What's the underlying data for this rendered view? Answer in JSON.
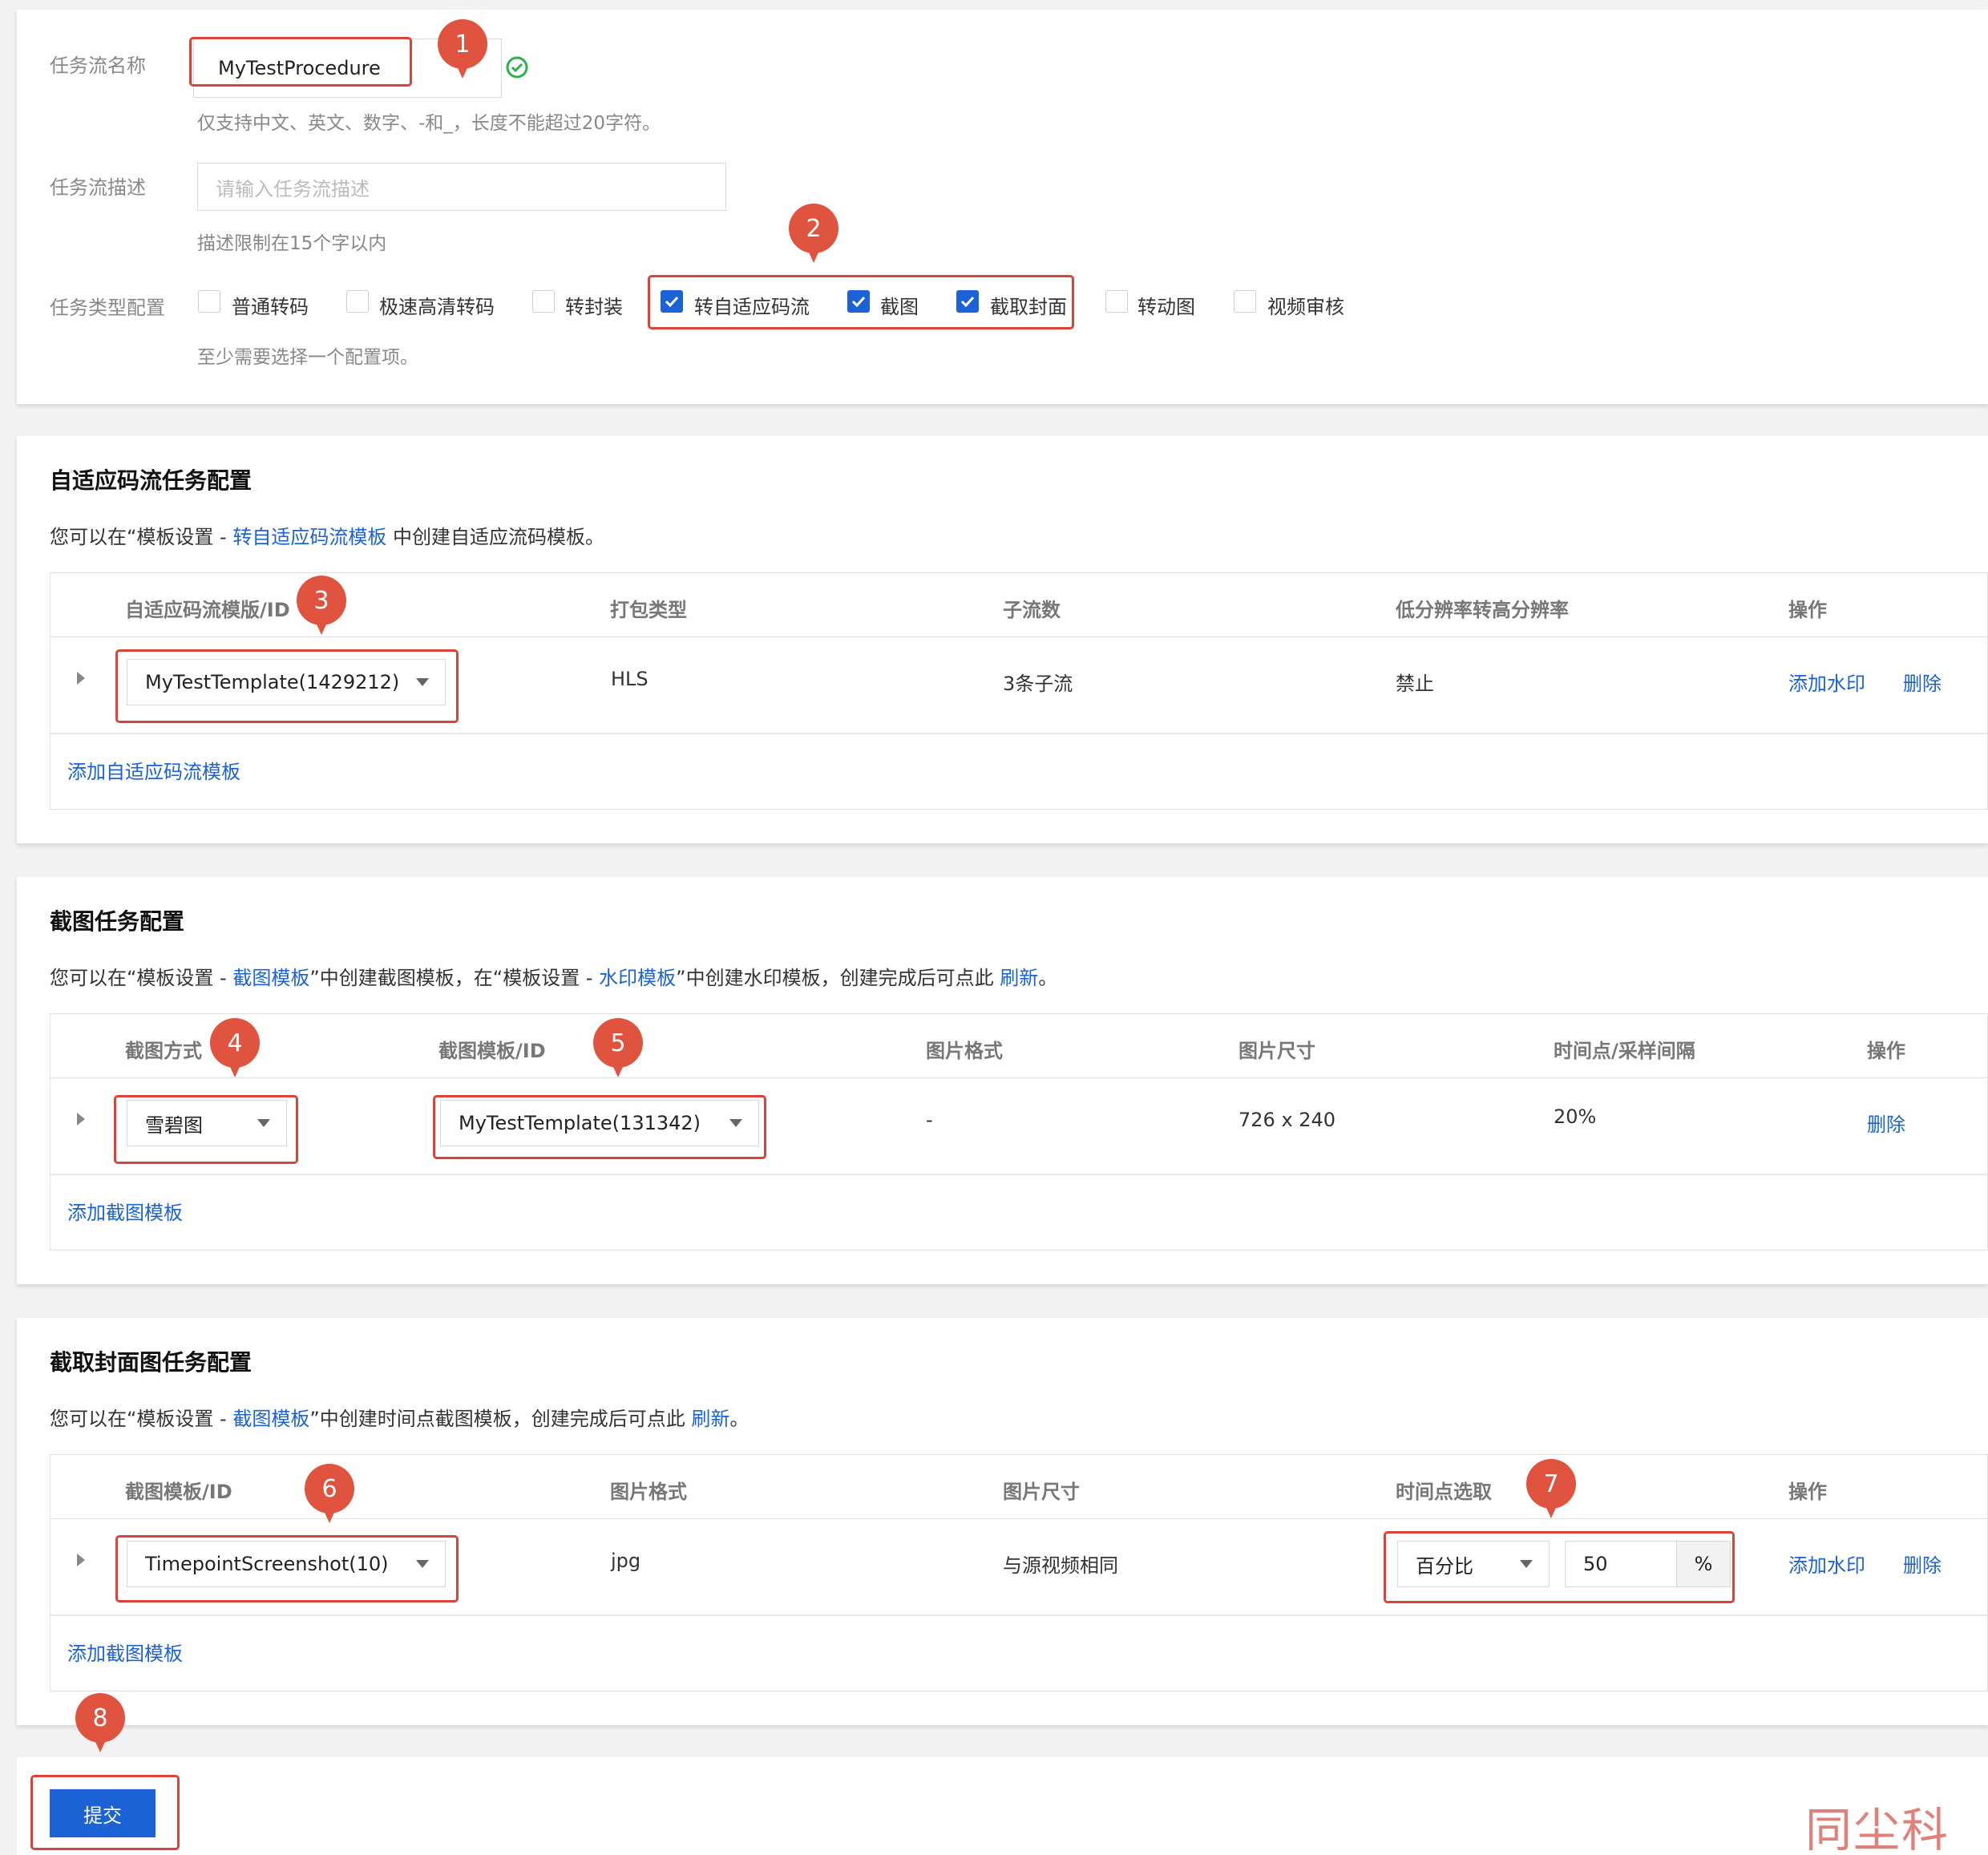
{
  "basic": {
    "name_label": "任务流名称",
    "name_value": "MyTestProcedure",
    "name_hint": "仅支持中文、英文、数字、-和_，长度不能超过20字符。",
    "desc_label": "任务流描述",
    "desc_placeholder": "请输入任务流描述",
    "desc_hint": "描述限制在15个字以内",
    "type_label": "任务类型配置",
    "type_hint": "至少需要选择一个配置项。",
    "types": [
      {
        "label": "普通转码",
        "checked": false
      },
      {
        "label": "极速高清转码",
        "checked": false
      },
      {
        "label": "转封装",
        "checked": false
      },
      {
        "label": "转自适应码流",
        "checked": true
      },
      {
        "label": "截图",
        "checked": true
      },
      {
        "label": "截取封面",
        "checked": true
      },
      {
        "label": "转动图",
        "checked": false
      },
      {
        "label": "视频审核",
        "checked": false
      }
    ]
  },
  "adaptive": {
    "title": "自适应码流任务配置",
    "desc_pre": "您可以在“模板设置 - ",
    "desc_link": "转自适应码流模板",
    "desc_post": " 中创建自适应流码模板。",
    "headers": [
      "自适应码流模版/ID",
      "打包类型",
      "子流数",
      "低分辨率转高分辨率",
      "操作"
    ],
    "row": {
      "template": "MyTestTemplate(1429212)",
      "package": "HLS",
      "streams": "3条子流",
      "upscale": "禁止",
      "action_watermark": "添加水印",
      "action_delete": "删除"
    },
    "add_link": "添加自适应码流模板"
  },
  "snapshot": {
    "title": "截图任务配置",
    "desc_pre": "您可以在“模板设置 - ",
    "desc_link1": "截图模板",
    "desc_mid": "”中创建截图模板，在“模板设置 - ",
    "desc_link2": "水印模板",
    "desc_post": "”中创建水印模板，创建完成后可点此 ",
    "desc_link3": "刷新",
    "desc_end": "。",
    "headers": [
      "截图方式",
      "截图模板/ID",
      "图片格式",
      "图片尺寸",
      "时间点/采样间隔",
      "操作"
    ],
    "row": {
      "mode": "雪碧图",
      "template": "MyTestTemplate(131342)",
      "format": "-",
      "size": "726 x 240",
      "interval": "20%",
      "action_delete": "删除"
    },
    "add_link": "添加截图模板"
  },
  "cover": {
    "title": "截取封面图任务配置",
    "desc_pre": "您可以在“模板设置 - ",
    "desc_link": "截图模板",
    "desc_post": "”中创建时间点截图模板，创建完成后可点此 ",
    "desc_link2": "刷新",
    "desc_end": "。",
    "headers": [
      "截图模板/ID",
      "图片格式",
      "图片尺寸",
      "时间点选取",
      "操作"
    ],
    "row": {
      "template": "TimepointScreenshot(10)",
      "format": "jpg",
      "size": "与源视频相同",
      "time_mode": "百分比",
      "time_value": "50",
      "time_unit": "%",
      "action_watermark": "添加水印",
      "action_delete": "删除"
    },
    "add_link": "添加截图模板"
  },
  "submit_label": "提交",
  "markers": [
    "1",
    "2",
    "3",
    "4",
    "5",
    "6",
    "7",
    "8"
  ],
  "watermark": "同尘科技",
  "colors": {
    "accent": "#1a62d6",
    "marker": "#e0533f",
    "highlight": "#d9443a"
  }
}
